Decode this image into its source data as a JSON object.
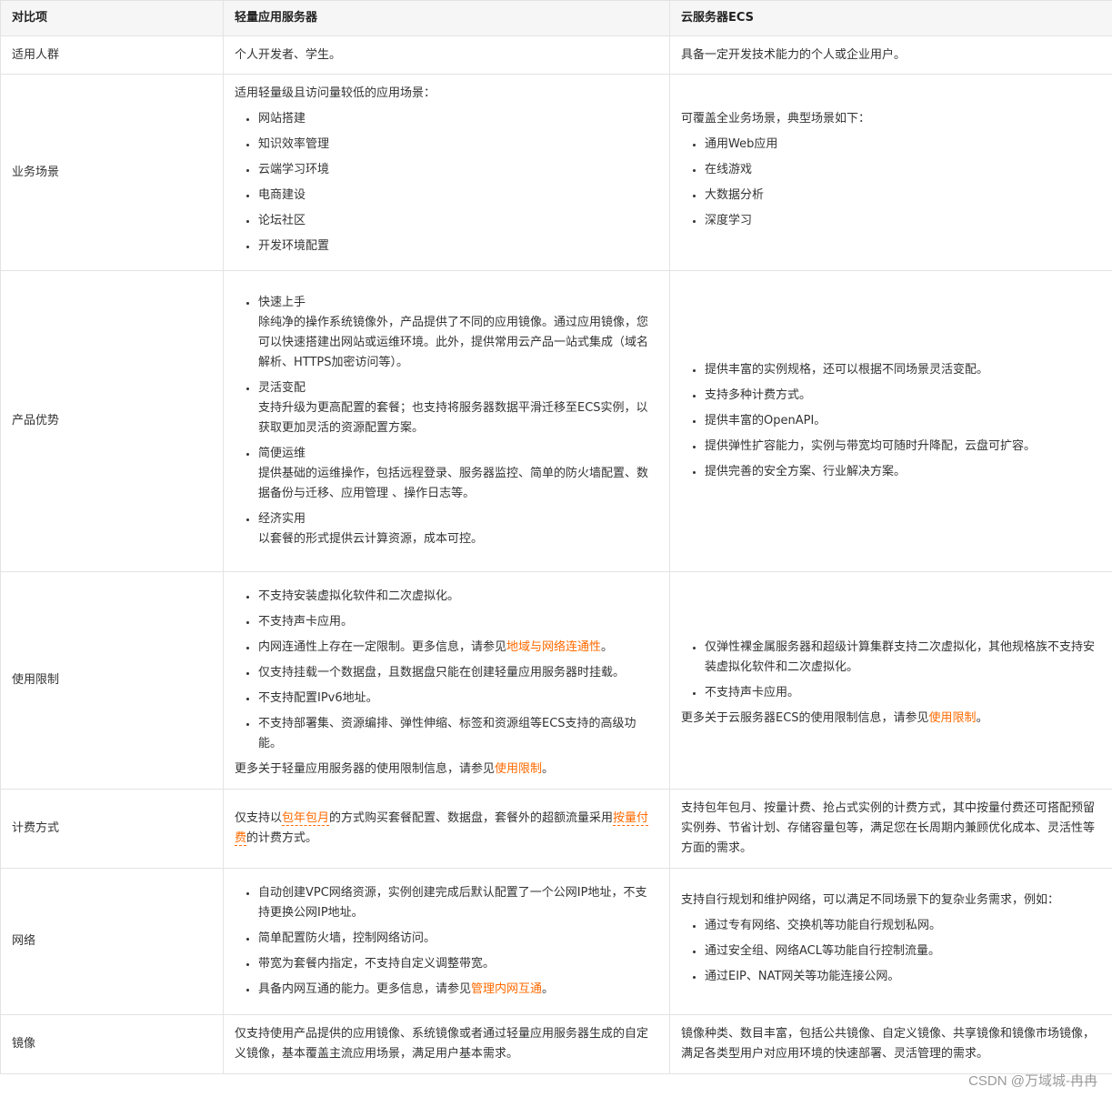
{
  "header": {
    "col1": "对比项",
    "col2": "轻量应用服务器",
    "col3": "云服务器ECS"
  },
  "rows": {
    "audience": {
      "label": "适用人群",
      "swas": "个人开发者、学生。",
      "ecs": "具备一定开发技术能力的个人或企业用户。"
    },
    "scenarios": {
      "label": "业务场景",
      "swas_intro": "适用轻量级且访问量较低的应用场景：",
      "swas_items": [
        "网站搭建",
        "知识效率管理",
        "云端学习环境",
        "电商建设",
        "论坛社区",
        "开发环境配置"
      ],
      "ecs_intro": "可覆盖全业务场景，典型场景如下：",
      "ecs_items": [
        "通用Web应用",
        "在线游戏",
        "大数据分析",
        "深度学习"
      ]
    },
    "advantages": {
      "label": "产品优势",
      "swas_items": [
        {
          "title": "快速上手",
          "desc": "除纯净的操作系统镜像外，产品提供了不同的应用镜像。通过应用镜像，您可以快速搭建出网站或运维环境。此外，提供常用云产品一站式集成（域名解析、HTTPS加密访问等）。"
        },
        {
          "title": "灵活变配",
          "desc": "支持升级为更高配置的套餐；也支持将服务器数据平滑迁移至ECS实例，以获取更加灵活的资源配置方案。"
        },
        {
          "title": "简便运维",
          "desc": "提供基础的运维操作，包括远程登录、服务器监控、简单的防火墙配置、数据备份与迁移、应用管理 、操作日志等。"
        },
        {
          "title": "经济实用",
          "desc": "以套餐的形式提供云计算资源，成本可控。"
        }
      ],
      "ecs_items": [
        "提供丰富的实例规格，还可以根据不同场景灵活变配。",
        "支持多种计费方式。",
        "提供丰富的OpenAPI。",
        "提供弹性扩容能力，实例与带宽均可随时升降配，云盘可扩容。",
        "提供完善的安全方案、行业解决方案。"
      ]
    },
    "limits": {
      "label": "使用限制",
      "swas_item1": "不支持安装虚拟化软件和二次虚拟化。",
      "swas_item2": "不支持声卡应用。",
      "swas_item3_pre": "内网连通性上存在一定限制。更多信息，请参见",
      "swas_item3_link": "地域与网络连通性",
      "swas_item3_post": "。",
      "swas_item4": "仅支持挂载一个数据盘，且数据盘只能在创建轻量应用服务器时挂载。",
      "swas_item5": "不支持配置IPv6地址。",
      "swas_item6": "不支持部署集、资源编排、弹性伸缩、标签和资源组等ECS支持的高级功能。",
      "swas_more_pre": "更多关于轻量应用服务器的使用限制信息，请参见",
      "swas_more_link": "使用限制",
      "swas_more_post": "。",
      "ecs_item1": "仅弹性裸金属服务器和超级计算集群支持二次虚拟化，其他规格族不支持安装虚拟化软件和二次虚拟化。",
      "ecs_item2": "不支持声卡应用。",
      "ecs_more_pre": "更多关于云服务器ECS的使用限制信息，请参见",
      "ecs_more_link": "使用限制",
      "ecs_more_post": "。"
    },
    "billing": {
      "label": "计费方式",
      "swas_pre": "仅支持以",
      "swas_link1": "包年包月",
      "swas_mid": "的方式购买套餐配置、数据盘，套餐外的超额流量采用",
      "swas_link2": "按量付费",
      "swas_post": "的计费方式。",
      "ecs": "支持包年包月、按量计费、抢占式实例的计费方式，其中按量付费还可搭配预留实例券、节省计划、存储容量包等，满足您在长周期内兼顾优化成本、灵活性等方面的需求。"
    },
    "network": {
      "label": "网络",
      "swas_item1": "自动创建VPC网络资源，实例创建完成后默认配置了一个公网IP地址，不支持更换公网IP地址。",
      "swas_item2": "简单配置防火墙，控制网络访问。",
      "swas_item3": "带宽为套餐内指定，不支持自定义调整带宽。",
      "swas_item4_pre": "具备内网互通的能力。更多信息，请参见",
      "swas_item4_link": "管理内网互通",
      "swas_item4_post": "。",
      "ecs_intro": "支持自行规划和维护网络，可以满足不同场景下的复杂业务需求，例如：",
      "ecs_items": [
        "通过专有网络、交换机等功能自行规划私网。",
        "通过安全组、网络ACL等功能自行控制流量。",
        "通过EIP、NAT网关等功能连接公网。"
      ]
    },
    "image": {
      "label": "镜像",
      "swas": "仅支持使用产品提供的应用镜像、系统镜像或者通过轻量应用服务器生成的自定义镜像，基本覆盖主流应用场景，满足用户基本需求。",
      "ecs": "镜像种类、数目丰富，包括公共镜像、自定义镜像、共享镜像和镜像市场镜像，满足各类型用户对应用环境的快速部署、灵活管理的需求。"
    }
  },
  "watermark": "CSDN @万域城-冉冉",
  "colors": {
    "link": "#ff6a00",
    "header_bg": "#f6f6f6",
    "border": "#e3e3e3"
  }
}
